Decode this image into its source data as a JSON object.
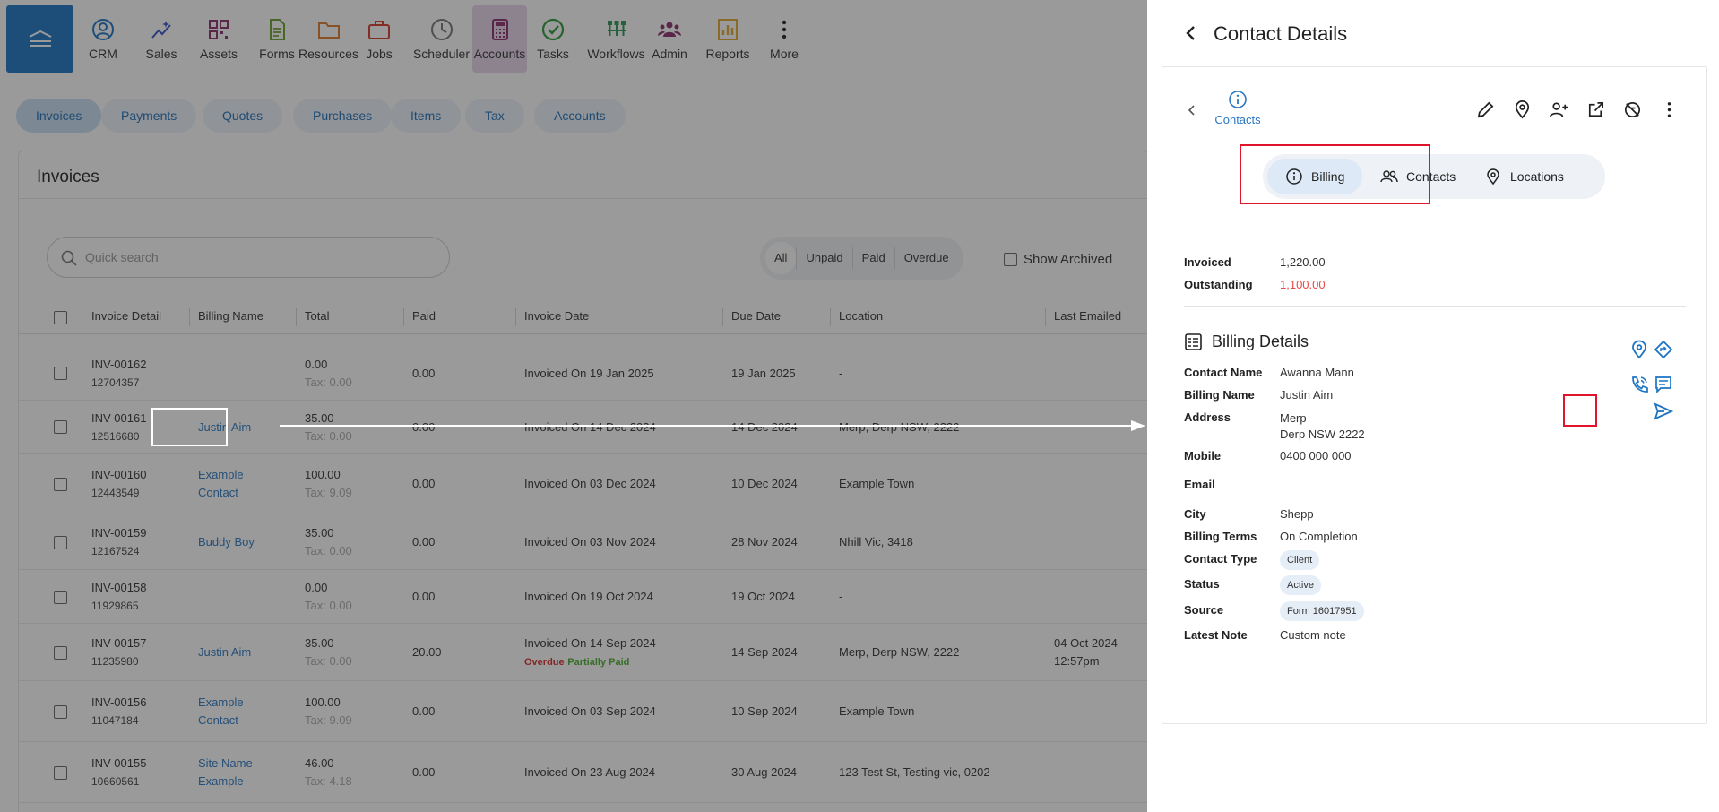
{
  "nav": {
    "items": [
      {
        "label": "CRM",
        "icon": "user-circle-icon",
        "color": "#1d74c4"
      },
      {
        "label": "Sales",
        "icon": "sparkle-chart-icon",
        "color": "#3a52c8"
      },
      {
        "label": "Assets",
        "icon": "qr-code-icon",
        "color": "#8a2f6e"
      },
      {
        "label": "Forms",
        "icon": "document-icon",
        "color": "#6aa12e"
      },
      {
        "label": "Resources",
        "icon": "folder-icon",
        "color": "#e07a2c"
      },
      {
        "label": "Jobs",
        "icon": "briefcase-icon",
        "color": "#d83a2a"
      },
      {
        "label": "Scheduler",
        "icon": "clock-icon",
        "color": "#777777"
      },
      {
        "label": "Accounts",
        "icon": "calculator-icon",
        "color": "#8a2f6e"
      },
      {
        "label": "Tasks",
        "icon": "check-circle-icon",
        "color": "#2a9a3a"
      },
      {
        "label": "Workflows",
        "icon": "workflow-icon",
        "color": "#2a9a55"
      },
      {
        "label": "Admin",
        "icon": "users-icon",
        "color": "#8a2f6e"
      },
      {
        "label": "Reports",
        "icon": "bar-chart-icon",
        "color": "#e0a82c"
      },
      {
        "label": "More",
        "icon": "more-vertical-icon",
        "color": "#222222"
      }
    ]
  },
  "subtabs": [
    "Invoices",
    "Payments",
    "Quotes",
    "Purchases",
    "Items",
    "Tax",
    "Accounts"
  ],
  "invoices": {
    "title": "Invoices",
    "search_placeholder": "Quick search",
    "filters": [
      "All",
      "Unpaid",
      "Paid",
      "Overdue"
    ],
    "show_archived": "Show Archived",
    "columns": [
      "Invoice Detail",
      "Billing Name",
      "Total",
      "Paid",
      "Invoice Date",
      "Due Date",
      "Location",
      "Last Emailed"
    ],
    "rows": [
      {
        "number": "INV-00162",
        "id": "12704357",
        "billing": [],
        "total": "0.00",
        "tax": "Tax: 0.00",
        "paid": "0.00",
        "date": "Invoiced On 19 Jan 2025",
        "overdue": "",
        "partial": "",
        "due": "19 Jan 2025",
        "location": "-",
        "emailed": [],
        "highlighted": false
      },
      {
        "number": "INV-00161",
        "id": "12516680",
        "billing": [
          "Justin Aim"
        ],
        "total": "35.00",
        "tax": "Tax: 0.00",
        "paid": "0.00",
        "date": "Invoiced On 14 Dec 2024",
        "overdue": "",
        "partial": "",
        "due": "14 Dec 2024",
        "location": "Merp, Derp NSW, 2222",
        "emailed": [],
        "highlighted": true
      },
      {
        "number": "INV-00160",
        "id": "12443549",
        "billing": [
          "Example",
          "Contact"
        ],
        "total": "100.00",
        "tax": "Tax: 9.09",
        "paid": "0.00",
        "date": "Invoiced On 03 Dec 2024",
        "overdue": "",
        "partial": "",
        "due": "10 Dec 2024",
        "location": "Example Town",
        "emailed": [],
        "highlighted": false
      },
      {
        "number": "INV-00159",
        "id": "12167524",
        "billing": [
          "Buddy Boy"
        ],
        "total": "35.00",
        "tax": "Tax: 0.00",
        "paid": "0.00",
        "date": "Invoiced On 03 Nov 2024",
        "overdue": "",
        "partial": "",
        "due": "28 Nov 2024",
        "location": "Nhill Vic, 3418",
        "emailed": [],
        "highlighted": false
      },
      {
        "number": "INV-00158",
        "id": "11929865",
        "billing": [],
        "total": "0.00",
        "tax": "Tax: 0.00",
        "paid": "0.00",
        "date": "Invoiced On 19 Oct 2024",
        "overdue": "",
        "partial": "",
        "due": "19 Oct 2024",
        "location": "-",
        "emailed": [],
        "highlighted": false
      },
      {
        "number": "INV-00157",
        "id": "11235980",
        "billing": [
          "Justin Aim"
        ],
        "total": "35.00",
        "tax": "Tax: 0.00",
        "paid": "20.00",
        "date": "Invoiced On 14 Sep 2024",
        "overdue": "Overdue",
        "partial": "Partially Paid",
        "due": "14 Sep 2024",
        "location": "Merp, Derp NSW, 2222",
        "emailed": [
          "04 Oct 2024",
          "12:57pm"
        ],
        "highlighted": false
      },
      {
        "number": "INV-00156",
        "id": "11047184",
        "billing": [
          "Example",
          "Contact"
        ],
        "total": "100.00",
        "tax": "Tax: 9.09",
        "paid": "0.00",
        "date": "Invoiced On 03 Sep 2024",
        "overdue": "",
        "partial": "",
        "due": "10 Sep 2024",
        "location": "Example Town",
        "emailed": [],
        "highlighted": false
      },
      {
        "number": "INV-00155",
        "id": "10660561",
        "billing": [
          "Site Name",
          "Example"
        ],
        "total": "46.00",
        "tax": "Tax: 4.18",
        "paid": "0.00",
        "date": "Invoiced On 23 Aug 2024",
        "overdue": "",
        "partial": "",
        "due": "30 Aug 2024",
        "location": "123 Test St, Testing vic, 0202",
        "emailed": [],
        "highlighted": false
      }
    ]
  },
  "panel": {
    "title": "Contact Details",
    "crumb": "Contacts",
    "tabs": [
      {
        "label": "Billing",
        "icon": "info-icon"
      },
      {
        "label": "Contacts",
        "icon": "users-icon"
      },
      {
        "label": "Locations",
        "icon": "map-pin-icon"
      }
    ],
    "summary": [
      {
        "label": "Invoiced",
        "value": "1,220.00",
        "color": "#333333"
      },
      {
        "label": "Outstanding",
        "value": "1,100.00",
        "color": "#e84a4a"
      }
    ],
    "billing_title": "Billing Details",
    "details": [
      {
        "label": "Contact Name",
        "value": [
          "Awanna Mann"
        ],
        "chip": false
      },
      {
        "label": "Billing Name",
        "value": [
          "Justin Aim"
        ],
        "chip": false
      },
      {
        "label": "Address",
        "value": [
          "Merp",
          "Derp NSW 2222"
        ],
        "chip": false
      },
      {
        "label": "Mobile",
        "value": [
          "0400 000 000"
        ],
        "chip": false
      },
      {
        "label": "Email",
        "value": [],
        "chip": false
      },
      {
        "label": "City",
        "value": [
          "Shepp"
        ],
        "chip": false
      },
      {
        "label": "Billing Terms",
        "value": [
          "On Completion"
        ],
        "chip": false
      },
      {
        "label": "Contact Type",
        "value": [
          "Client"
        ],
        "chip": true
      },
      {
        "label": "Status",
        "value": [
          "Active"
        ],
        "chip": true
      },
      {
        "label": "Source",
        "value": [
          "Form 16017951"
        ],
        "chip": true
      },
      {
        "label": "Latest Note",
        "value": [
          "Custom note"
        ],
        "chip": false
      }
    ]
  },
  "colors": {
    "accent": "#1d74c4",
    "link": "#2a78c4",
    "highlight": "#e0142a"
  }
}
